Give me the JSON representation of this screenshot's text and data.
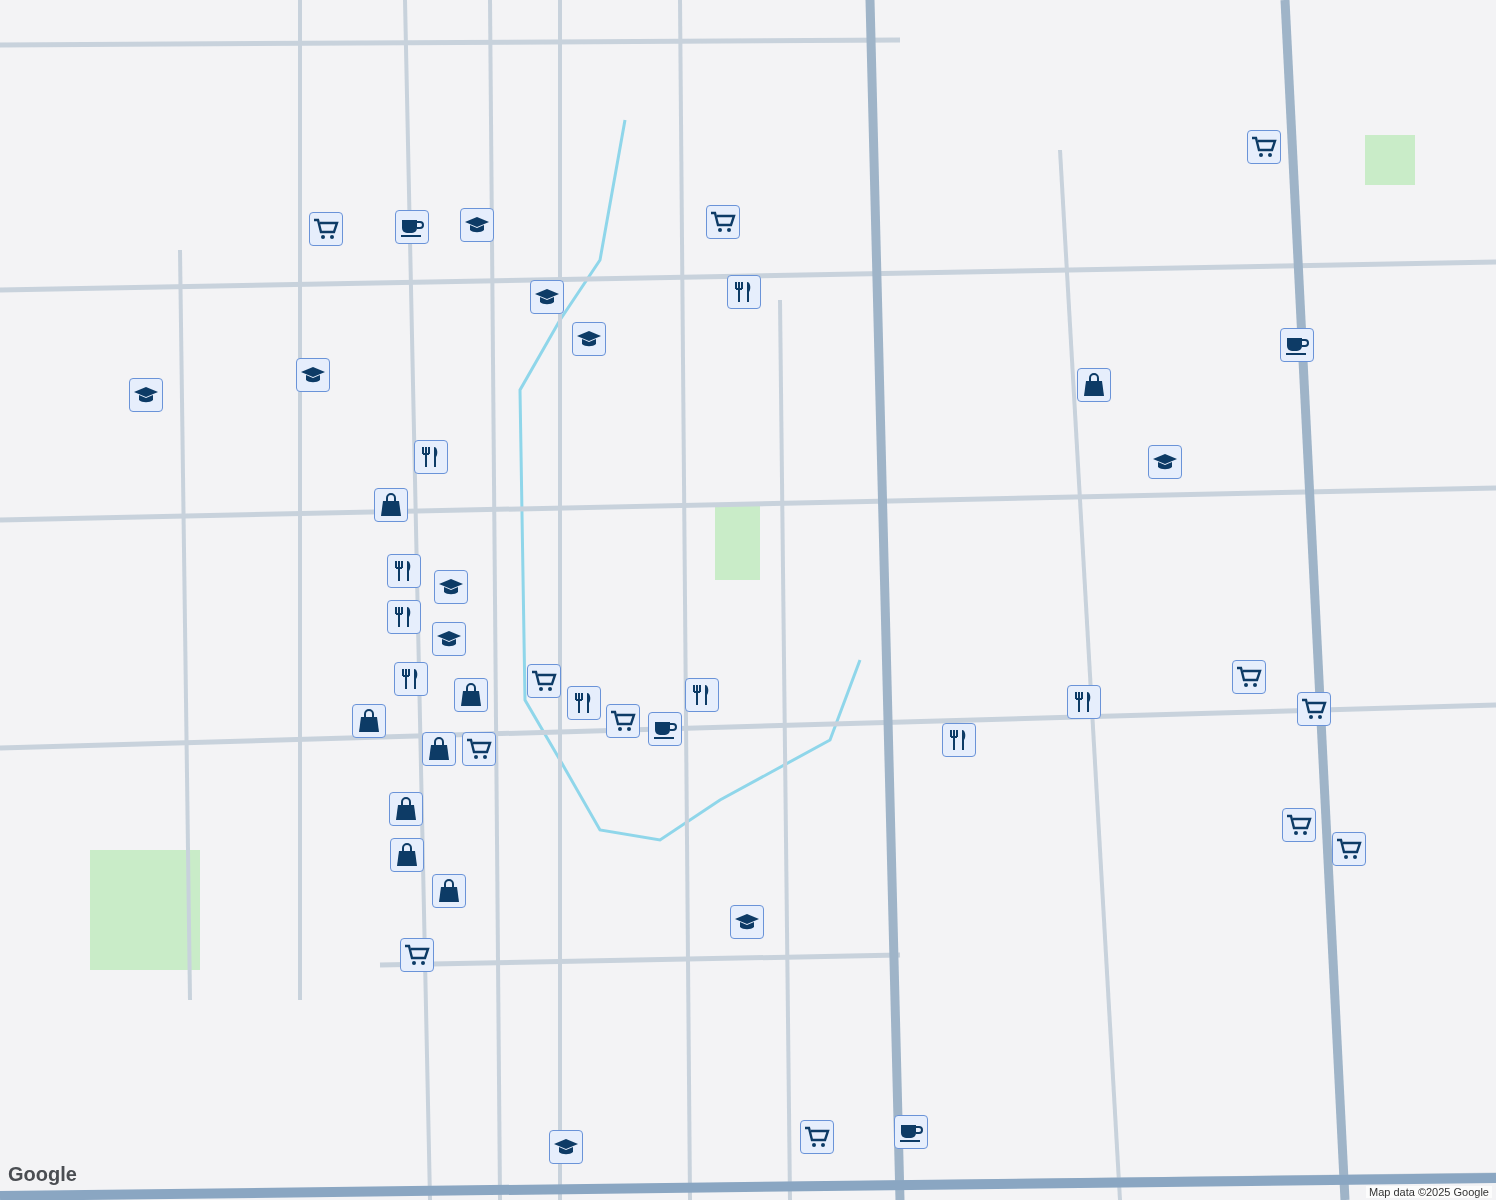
{
  "map": {
    "markers": [
      {
        "kind": "cart"
      },
      {
        "kind": "cart"
      },
      {
        "kind": "cart"
      },
      {
        "kind": "cart"
      },
      {
        "kind": "cart"
      },
      {
        "kind": "cart"
      },
      {
        "kind": "cart"
      },
      {
        "kind": "cart"
      },
      {
        "kind": "cart"
      },
      {
        "kind": "cart"
      },
      {
        "kind": "cart"
      },
      {
        "kind": "cart"
      },
      {
        "kind": "cup"
      },
      {
        "kind": "cup"
      },
      {
        "kind": "cup"
      },
      {
        "kind": "cup"
      },
      {
        "kind": "school"
      },
      {
        "kind": "school"
      },
      {
        "kind": "school"
      },
      {
        "kind": "school"
      },
      {
        "kind": "school"
      },
      {
        "kind": "school"
      },
      {
        "kind": "school"
      },
      {
        "kind": "school"
      },
      {
        "kind": "school"
      },
      {
        "kind": "school"
      },
      {
        "kind": "food"
      },
      {
        "kind": "food"
      },
      {
        "kind": "food"
      },
      {
        "kind": "food"
      },
      {
        "kind": "food"
      },
      {
        "kind": "food"
      },
      {
        "kind": "food"
      },
      {
        "kind": "food"
      },
      {
        "kind": "food"
      },
      {
        "kind": "bag"
      },
      {
        "kind": "bag"
      },
      {
        "kind": "bag"
      },
      {
        "kind": "bag"
      },
      {
        "kind": "bag"
      },
      {
        "kind": "bag"
      },
      {
        "kind": "bag"
      },
      {
        "kind": "bag"
      }
    ],
    "logo": "Google",
    "attribution": "Map data ©2025 Google"
  }
}
